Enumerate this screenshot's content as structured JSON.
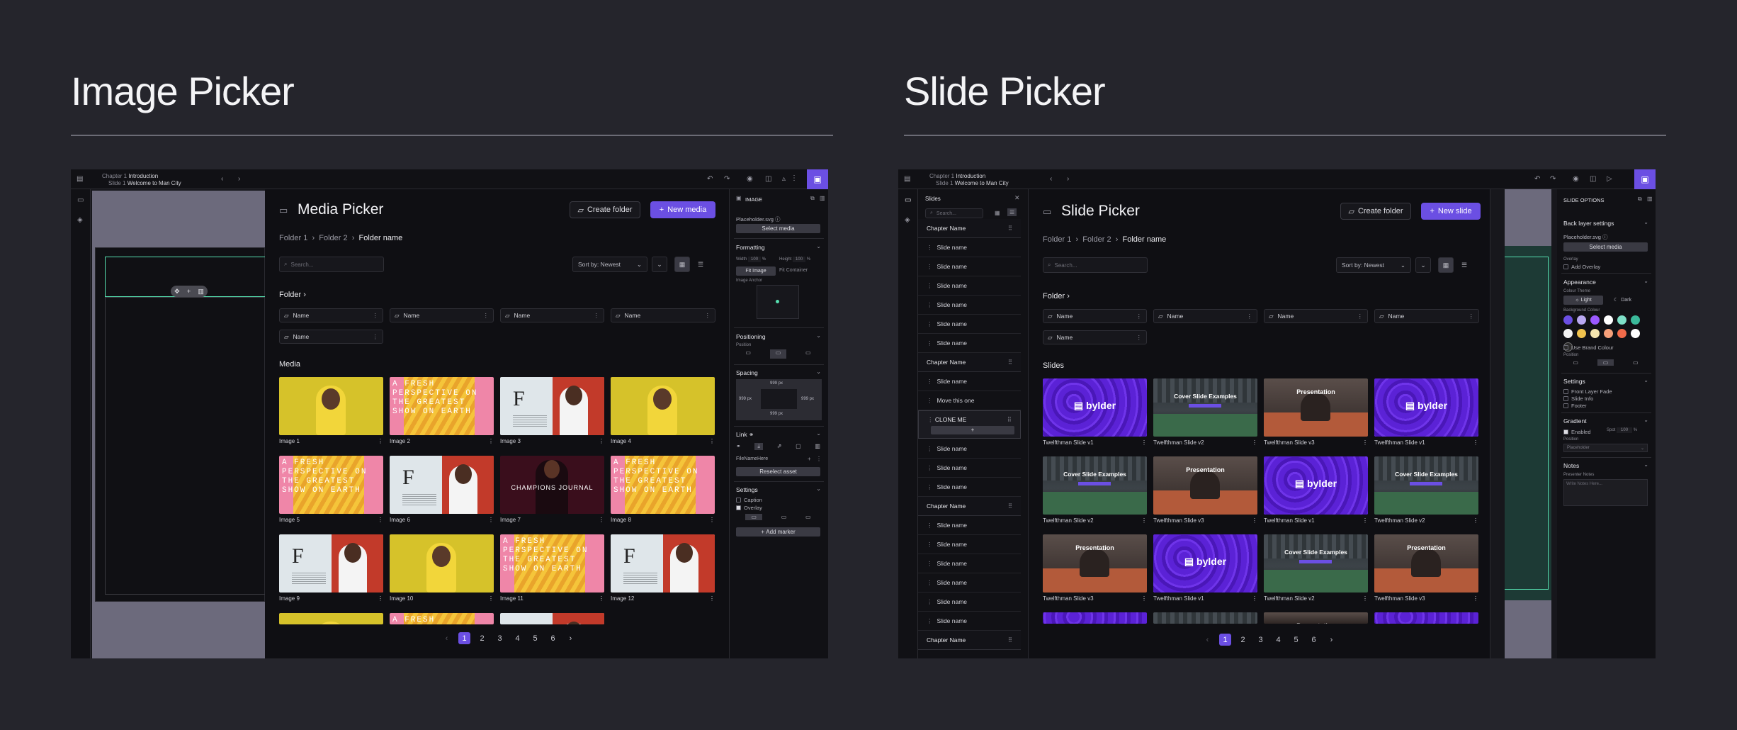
{
  "headings": {
    "left": "Image Picker",
    "right": "Slide Picker"
  },
  "app": {
    "crumb_chapter_label": "Chapter 1",
    "crumb_chapter": "Introduction",
    "crumb_slide_label": "Slide 1",
    "crumb_slide": "Welcome to Man City"
  },
  "media_picker": {
    "title": "Media Picker",
    "create_folder": "Create folder",
    "new_media": "New media",
    "breadcrumb": [
      "Folder 1",
      "Folder 2",
      "Folder name"
    ],
    "search_placeholder": "Search...",
    "sort": "Sort by: Newest",
    "folder_section": "Folder",
    "folders": [
      "Name",
      "Name",
      "Name",
      "Name",
      "Name"
    ],
    "media_section": "Media",
    "images": [
      "Image 1",
      "Image 2",
      "Image 3",
      "Image 4",
      "Image 5",
      "Image 6",
      "Image 7",
      "Image 8",
      "Image 9",
      "Image 10",
      "Image 11",
      "Image 12"
    ],
    "thumb_text": {
      "poster": "A FRESH PERSPECTIVE ON THE GREATEST SHOW ON EARTH",
      "journal": "CHAMPIONS JOURNAL",
      "f": "F"
    },
    "pages": [
      "1",
      "2",
      "3",
      "4",
      "5",
      "6"
    ],
    "current_page": 1
  },
  "image_panel": {
    "header": "IMAGE",
    "file": "Placeholder.svg",
    "select_media": "Select media",
    "formatting": "Formatting",
    "width_label": "Width",
    "width": "100",
    "width_unit": "%",
    "height_label": "Height",
    "height": "100",
    "height_unit": "%",
    "fit_image": "Fit Image",
    "fit_container": "Fit Container",
    "anchor": "Image Anchor",
    "positioning": "Positioning",
    "position_label": "Position",
    "spacing": "Spacing",
    "spacing_top": "999 px",
    "spacing_left": "999 px",
    "spacing_right": "999 px",
    "spacing_bottom": "999 px",
    "link": "Link",
    "file_name": "FileNameHere",
    "reselect": "Reselect asset",
    "settings": "Settings",
    "caption": "Caption",
    "overlay": "Overlay",
    "add_marker": "Add marker"
  },
  "slides_sidebar": {
    "title": "Slides",
    "search_placeholder": "Search...",
    "items": [
      {
        "type": "chapter",
        "label": "Chapter Name"
      },
      {
        "type": "slide",
        "label": "Slide name"
      },
      {
        "type": "slide",
        "label": "Slide name"
      },
      {
        "type": "slide",
        "label": "Slide name"
      },
      {
        "type": "slide",
        "label": "Slide name"
      },
      {
        "type": "slide",
        "label": "Slide name"
      },
      {
        "type": "slide",
        "label": "Slide name"
      },
      {
        "type": "chapter",
        "label": "Chapter Name"
      },
      {
        "type": "slide",
        "label": "Slide name"
      },
      {
        "type": "slide",
        "label": "Move this one"
      },
      {
        "type": "clone",
        "label": "CLONE ME"
      },
      {
        "type": "slide",
        "label": "Slide name"
      },
      {
        "type": "slide",
        "label": "Slide name"
      },
      {
        "type": "slide",
        "label": "Slide name"
      },
      {
        "type": "chapter",
        "label": "Chapter Name"
      },
      {
        "type": "slide",
        "label": "Slide name"
      },
      {
        "type": "slide",
        "label": "Slide name"
      },
      {
        "type": "slide",
        "label": "Slide name"
      },
      {
        "type": "slide",
        "label": "Slide name"
      },
      {
        "type": "slide",
        "label": "Slide name"
      },
      {
        "type": "slide",
        "label": "Slide name"
      },
      {
        "type": "chapter",
        "label": "Chapter Name"
      }
    ]
  },
  "slide_picker": {
    "title": "Slide Picker",
    "create_folder": "Create folder",
    "new_slide": "New slide",
    "breadcrumb": [
      "Folder 1",
      "Folder 2",
      "Folder name"
    ],
    "search_placeholder": "Search...",
    "sort": "Sort by: Newest",
    "folder_section": "Folder",
    "folders": [
      "Name",
      "Name",
      "Name",
      "Name",
      "Name"
    ],
    "slides_section": "Slides",
    "slides": [
      {
        "label": "Twelfthman Slide v1",
        "kind": "bylder"
      },
      {
        "label": "Twelfthman Slide v2",
        "kind": "cover"
      },
      {
        "label": "Twelfthman Slide v3",
        "kind": "presentation"
      },
      {
        "label": "Twelfthman Slide v1",
        "kind": "bylder"
      },
      {
        "label": "Twelfthman Slide v2",
        "kind": "cover"
      },
      {
        "label": "Twelfthman Slide v3",
        "kind": "presentation"
      },
      {
        "label": "Twelfthman Slide v1",
        "kind": "bylder"
      },
      {
        "label": "Twelfthman Slide v2",
        "kind": "cover"
      },
      {
        "label": "Twelfthman Slide v3",
        "kind": "presentation"
      },
      {
        "label": "Twelfthman Slide v1",
        "kind": "bylder"
      },
      {
        "label": "Twelfthman Slide v2",
        "kind": "cover"
      },
      {
        "label": "Twelfthman Slide v3",
        "kind": "presentation"
      }
    ],
    "thumb_text": {
      "bylder": "bylder",
      "cover": "Cover Slide Examples",
      "presentation": "Presentation"
    },
    "pages": [
      "1",
      "2",
      "3",
      "4",
      "5",
      "6"
    ],
    "current_page": 1
  },
  "slide_options": {
    "header": "SLIDE OPTIONS",
    "back_layer": "Back layer settings",
    "file": "Placeholder.svg",
    "select_media": "Select media",
    "overlay": "Overlay",
    "add_overlay": "Add Overlay",
    "appearance": "Appearance",
    "colour_theme": "Colour Theme",
    "light": "Light",
    "dark": "Dark",
    "background_colour": "Background Colour",
    "use_brand": "Use Brand Colour",
    "position": "Position",
    "settings": "Settings",
    "front_fade": "Front Layer Fade",
    "slide_info": "Slide Info",
    "footer": "Footer",
    "gradient": "Gradient",
    "enabled": "Enabled",
    "spot_label": "Spot",
    "spot": "100",
    "spot_unit": "%",
    "gradient_position": "Position",
    "gradient_select": "Placeholder",
    "notes": "Notes",
    "presenter_notes": "Presenter Notes",
    "notes_placeholder": "Write Notes Here...",
    "swatches": [
      "#6b4fe3",
      "#b9a8f0",
      "#9b59ff",
      "#ffffff",
      "#7fe0c8",
      "#3bb99a",
      "#f2f2f2",
      "#f0c24d",
      "#f5e6b0",
      "#f6a07a",
      "#f26b4a",
      "#ffffff",
      "#2a2a2a"
    ]
  }
}
